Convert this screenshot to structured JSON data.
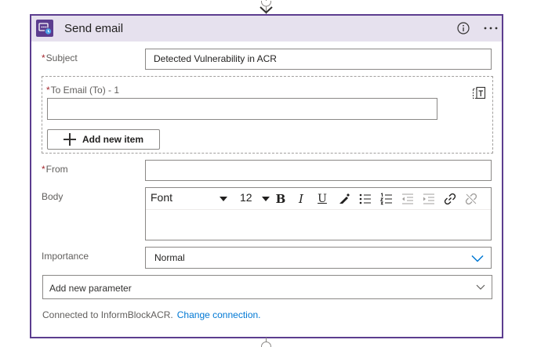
{
  "card": {
    "title": "Send email",
    "accent_color": "#5c3d8f",
    "header_bg": "#e6e1ee",
    "app_icon": "outlook-send-icon",
    "info_icon": "info-icon",
    "more_icon": "more-options-icon"
  },
  "fields": {
    "subject": {
      "required_mark": "*",
      "label": "Subject",
      "value": "Detected Vulnerability in ACR"
    },
    "to_email": {
      "required_mark": "*",
      "label": "To Email (To) - 1",
      "value": ""
    },
    "add_item_label": "Add new item",
    "switch_icon": "switch-to-text-mode-icon",
    "from": {
      "required_mark": "*",
      "label": "From",
      "value": ""
    },
    "body": {
      "label": "Body",
      "font": "Font",
      "size": "12",
      "toolbar": [
        "bold-icon",
        "italic-icon",
        "underline-icon",
        "color-picker-icon",
        "bulleted-list-icon",
        "numbered-list-icon",
        "outdent-icon",
        "indent-icon",
        "link-icon",
        "unlink-icon"
      ],
      "bold_glyph": "B",
      "italic_glyph": "I",
      "underline_glyph": "U"
    },
    "importance": {
      "label": "Importance",
      "value": "Normal"
    }
  },
  "add_parameter": {
    "label": "Add new parameter"
  },
  "footer": {
    "connection_text": "Connected to InformBlockACR.",
    "change_link": "Change connection."
  },
  "colors": {
    "link": "#0078d4",
    "required": "#a4262c",
    "chevron": "#0078d4"
  }
}
